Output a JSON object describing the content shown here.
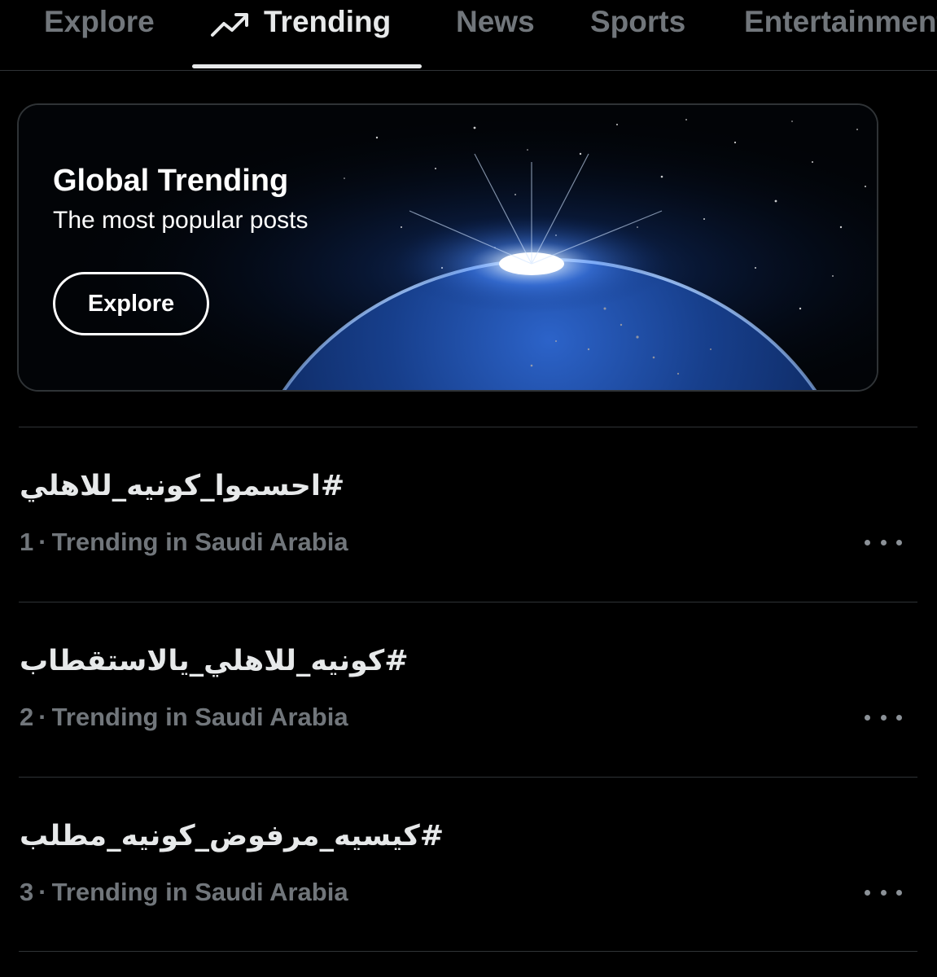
{
  "tabs": [
    {
      "label": "Explore",
      "active": false
    },
    {
      "label": "Trending",
      "active": true,
      "icon": "trending-up-icon"
    },
    {
      "label": "News",
      "active": false
    },
    {
      "label": "Sports",
      "active": false
    },
    {
      "label": "Entertainment",
      "active": false
    }
  ],
  "hero": {
    "title": "Global Trending",
    "subtitle": "The most popular posts",
    "button_label": "Explore",
    "image": "earth-from-space-sunrise"
  },
  "trends": [
    {
      "tag": "#احسموا_كونيه_للاهلي",
      "rank": "1",
      "separator": "·",
      "context": "Trending in Saudi Arabia",
      "more_icon": "more-horizontal-icon"
    },
    {
      "tag": "#كونيه_للاهلي_يالاستقطاب",
      "rank": "2",
      "separator": "·",
      "context": "Trending in Saudi Arabia",
      "more_icon": "more-horizontal-icon"
    },
    {
      "tag": "#كيسيه_مرفوض_كونيه_مطلب",
      "rank": "3",
      "separator": "·",
      "context": "Trending in Saudi Arabia",
      "more_icon": "more-horizontal-icon"
    }
  ],
  "colors": {
    "background": "#000000",
    "text_primary": "#e7e9ea",
    "text_secondary": "#71767b",
    "divider": "#2f3336",
    "indicator": "#e7e9ea"
  }
}
